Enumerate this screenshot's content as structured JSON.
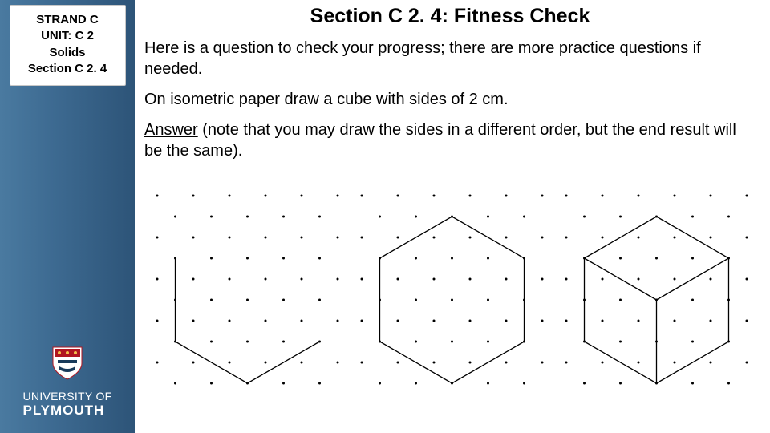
{
  "sidebar": {
    "strand": "STRAND C",
    "unit": "UNIT: C 2",
    "topic": "Solids",
    "section": "Section C 2. 4",
    "brand_uni": "UNIVERSITY OF",
    "brand_name": "PLYMOUTH"
  },
  "main": {
    "title": "Section C 2. 4: Fitness Check",
    "para1": "Here is a question to check your progress; there are more practice questions if needed.",
    "para2": "On isometric paper draw a cube with sides of 2 cm.",
    "answer_label": "Answer",
    "answer_rest": " (note that you may draw the sides in a different order, but the end result will be the same)."
  }
}
